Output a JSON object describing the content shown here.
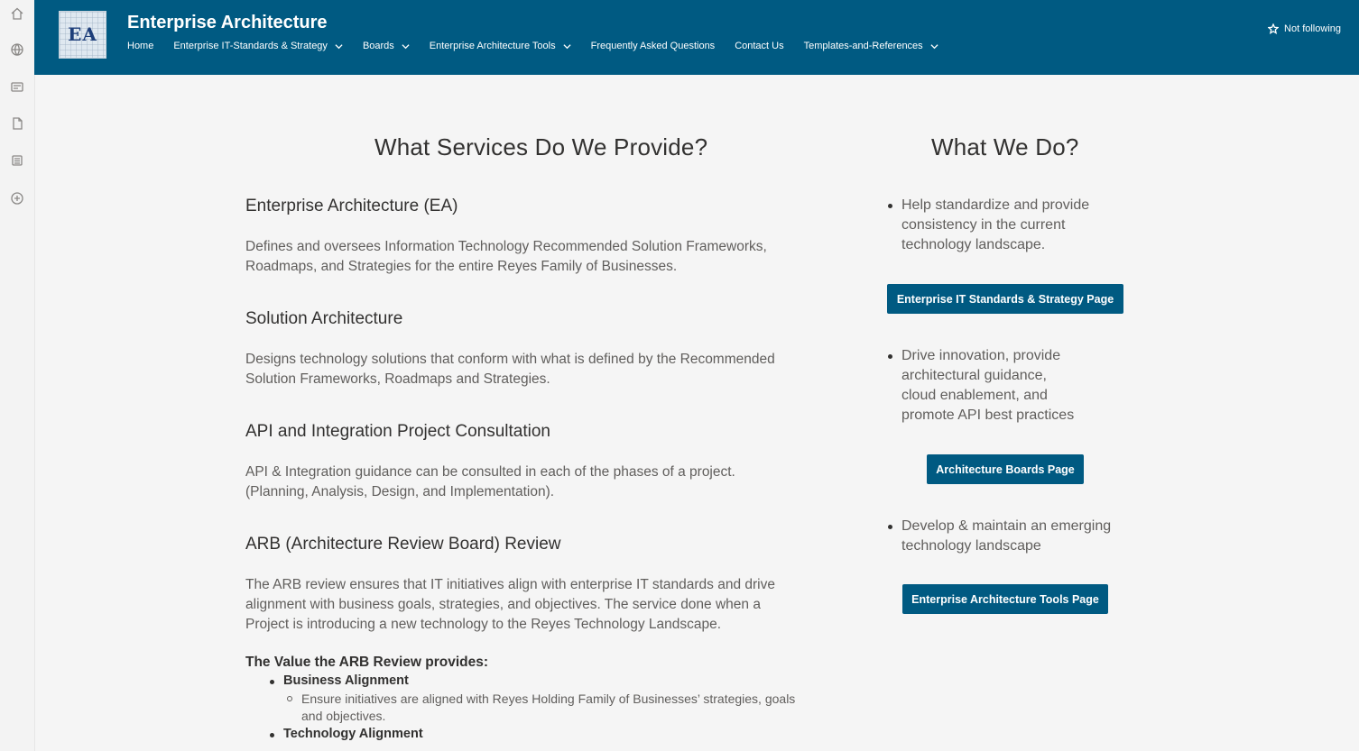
{
  "site": {
    "logo_text": "EA",
    "title": "Enterprise Architecture",
    "follow_label": "Not following"
  },
  "nav": [
    {
      "label": "Home",
      "has_dropdown": false
    },
    {
      "label": "Enterprise IT-Standards & Strategy",
      "has_dropdown": true
    },
    {
      "label": "Boards",
      "has_dropdown": true
    },
    {
      "label": "Enterprise Architecture Tools",
      "has_dropdown": true
    },
    {
      "label": "Frequently Asked Questions",
      "has_dropdown": false
    },
    {
      "label": "Contact Us",
      "has_dropdown": false
    },
    {
      "label": "Templates-and-References",
      "has_dropdown": true
    }
  ],
  "rail_icons": [
    "home-icon",
    "globe-icon",
    "news-icon",
    "file-icon",
    "list-icon",
    "add-icon"
  ],
  "services": {
    "heading": "What Services Do We Provide?",
    "items": [
      {
        "title": "Enterprise Architecture (EA)",
        "lines": [
          "Defines and oversees Information Technology Recommended Solution Frameworks,",
          "Roadmaps, and Strategies for the entire Reyes Family of Businesses."
        ]
      },
      {
        "title": "Solution Architecture",
        "lines": [
          "Designs technology solutions that conform with what is defined by the Recommended",
          "Solution Frameworks, Roadmaps and Strategies."
        ]
      },
      {
        "title": "API and Integration Project Consultation",
        "lines": [
          "API & Integration guidance can be consulted in each of the phases of a project.",
          "(Planning, Analysis, Design, and Implementation)."
        ]
      },
      {
        "title": "ARB (Architecture Review Board) Review",
        "lines": [
          "The ARB review ensures that IT initiatives align with enterprise IT standards and drive",
          "alignment with business goals, strategies, and objectives. The service done when a",
          "Project is introducing a new technology to the Reyes Technology Landscape."
        ]
      }
    ],
    "value_title": "The Value the ARB Review provides:",
    "value_items": [
      {
        "label": "Business Alignment",
        "sub": [
          "Ensure initiatives are aligned with Reyes Holding Family of Businesses’ strategies, goals",
          "and objectives."
        ]
      },
      {
        "label": "Technology Alignment"
      }
    ]
  },
  "what_we_do": {
    "heading": "What We Do?",
    "items": [
      {
        "lines": [
          "Help standardize and provide",
          "consistency in the current",
          "technology landscape."
        ],
        "button": "Enterprise IT Standards & Strategy Page"
      },
      {
        "lines": [
          "Drive innovation, provide",
          "architectural guidance,",
          "cloud enablement, and",
          "promote API best practices"
        ],
        "button": "Architecture Boards Page"
      },
      {
        "lines": [
          "Develop & maintain an emerging",
          "technology landscape"
        ],
        "button": "Enterprise Architecture Tools Page"
      }
    ]
  },
  "colors": {
    "header_bg": "#005a82",
    "button_bg": "#005a82",
    "page_bg": "#f5f5f5"
  }
}
